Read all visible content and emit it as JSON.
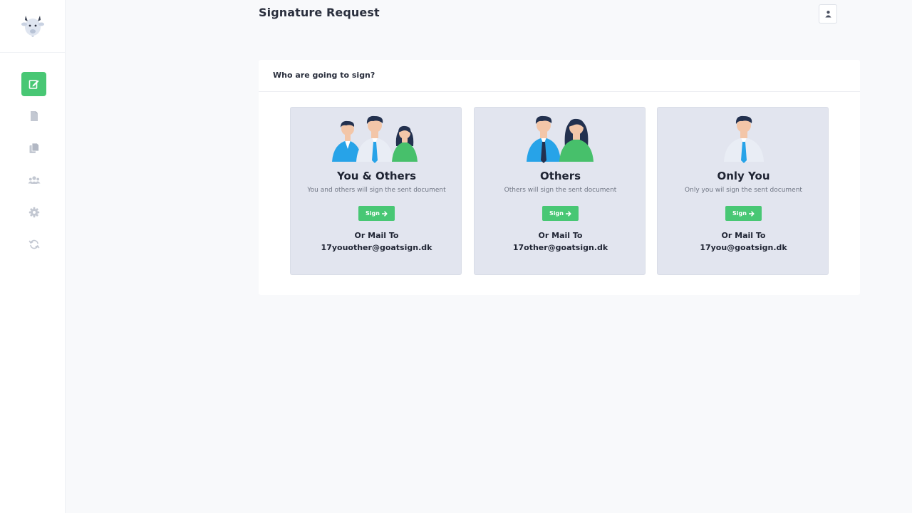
{
  "header": {
    "title": "Signature Request"
  },
  "sidebar": {
    "logo_icon": "goat-logo-icon",
    "items": [
      {
        "icon": "edit-icon",
        "active": true
      },
      {
        "icon": "document-icon",
        "active": false
      },
      {
        "icon": "documents-copy-icon",
        "active": false
      },
      {
        "icon": "users-icon",
        "active": false
      },
      {
        "icon": "gear-icon",
        "active": false
      },
      {
        "icon": "sync-icon",
        "active": false
      }
    ]
  },
  "panel": {
    "title": "Who are going to sign?",
    "cards": [
      {
        "title": "You & Others",
        "description": "You and others will sign the sent document",
        "button_label": "Sign",
        "mail_label": "Or Mail To",
        "mail_address": "17youother@goatsign.dk"
      },
      {
        "title": "Others",
        "description": "Others will sign the sent document",
        "button_label": "Sign",
        "mail_label": "Or Mail To",
        "mail_address": "17other@goatsign.dk"
      },
      {
        "title": "Only You",
        "description": "Only you wil sign the sent document",
        "button_label": "Sign",
        "mail_label": "Or Mail To",
        "mail_address": "17you@goatsign.dk"
      }
    ]
  },
  "colors": {
    "accent": "#48c774",
    "card_background": "#e2e5ef",
    "page_background": "#f8f9fb"
  }
}
